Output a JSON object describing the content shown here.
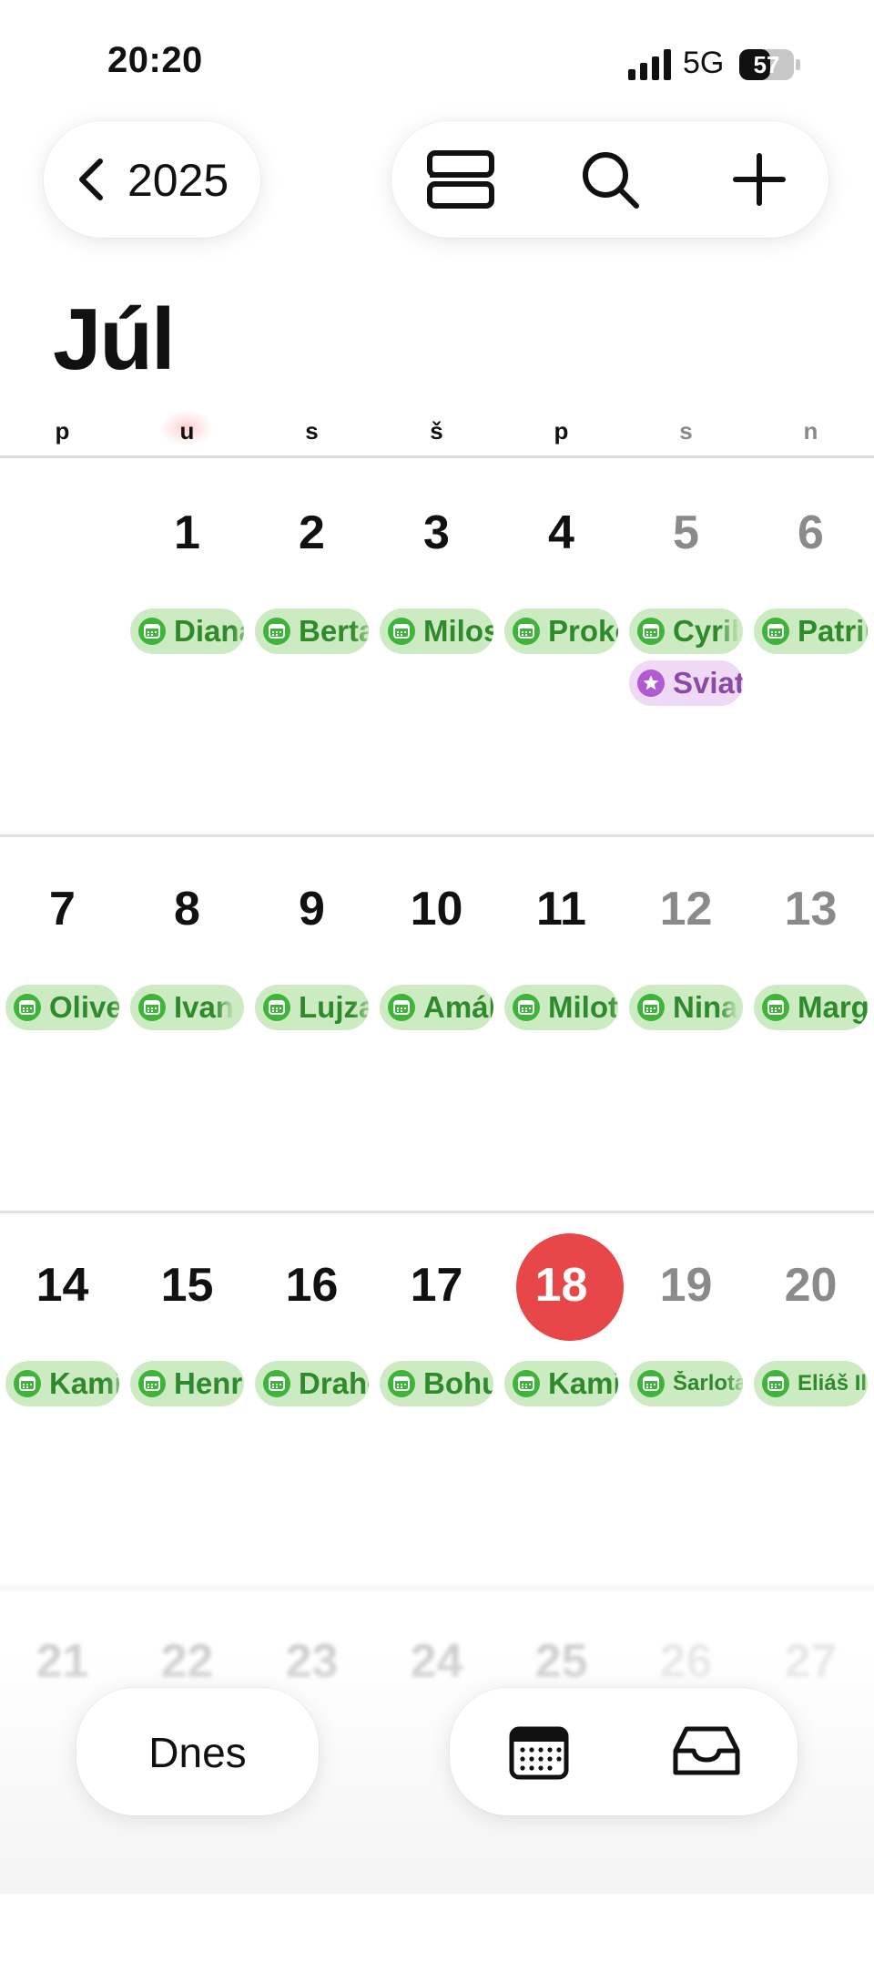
{
  "status_bar": {
    "time": "20:20",
    "network": "5G",
    "battery": "57"
  },
  "header": {
    "back_label": "2025"
  },
  "month": {
    "title": "Júl"
  },
  "weekdays": [
    "p",
    "u",
    "s",
    "š",
    "p",
    "s",
    "n"
  ],
  "weeks": [
    {
      "days": [
        {
          "num": "",
          "events": []
        },
        {
          "num": "1",
          "events": [
            {
              "label": "Diana"
            }
          ]
        },
        {
          "num": "2",
          "events": [
            {
              "label": "Berta"
            }
          ]
        },
        {
          "num": "3",
          "events": [
            {
              "label": "Miloslav"
            }
          ]
        },
        {
          "num": "4",
          "events": [
            {
              "label": "Prokop"
            }
          ]
        },
        {
          "num": "5",
          "weekend": true,
          "events": [
            {
              "label": "Cyril"
            },
            {
              "label": "Sviatok",
              "type": "holiday"
            }
          ]
        },
        {
          "num": "6",
          "weekend": true,
          "events": [
            {
              "label": "Patrik"
            }
          ]
        }
      ]
    },
    {
      "days": [
        {
          "num": "7",
          "events": [
            {
              "label": "Oliver"
            }
          ]
        },
        {
          "num": "8",
          "events": [
            {
              "label": "Ivan"
            }
          ]
        },
        {
          "num": "9",
          "events": [
            {
              "label": "Lujza"
            }
          ]
        },
        {
          "num": "10",
          "events": [
            {
              "label": "Amália"
            }
          ]
        },
        {
          "num": "11",
          "events": [
            {
              "label": "Milota"
            }
          ]
        },
        {
          "num": "12",
          "weekend": true,
          "events": [
            {
              "label": "Nina"
            }
          ]
        },
        {
          "num": "13",
          "weekend": true,
          "events": [
            {
              "label": "Margita"
            }
          ]
        }
      ]
    },
    {
      "days": [
        {
          "num": "14",
          "events": [
            {
              "label": "Kamil"
            }
          ]
        },
        {
          "num": "15",
          "events": [
            {
              "label": "Henrieta"
            }
          ]
        },
        {
          "num": "16",
          "events": [
            {
              "label": "Drahomír"
            }
          ]
        },
        {
          "num": "17",
          "events": [
            {
              "label": "Bohuslav"
            }
          ]
        },
        {
          "num": "18",
          "today": true,
          "events": [
            {
              "label": "Kamila"
            }
          ]
        },
        {
          "num": "19",
          "weekend": true,
          "events": [
            {
              "label": "Šarlota",
              "small": true
            }
          ]
        },
        {
          "num": "20",
          "weekend": true,
          "events": [
            {
              "label": "Eliáš Ilja",
              "small": true
            }
          ]
        }
      ]
    },
    {
      "days": [
        {
          "num": "21",
          "events": []
        },
        {
          "num": "22",
          "events": []
        },
        {
          "num": "23",
          "events": []
        },
        {
          "num": "24",
          "events": []
        },
        {
          "num": "25",
          "events": []
        },
        {
          "num": "26",
          "weekend": true,
          "events": []
        },
        {
          "num": "27",
          "weekend": true,
          "events": []
        }
      ]
    }
  ],
  "bottom": {
    "today_label": "Dnes"
  },
  "colors": {
    "today_accent": "#e8474a",
    "event_bg": "#cdebc2",
    "event_text": "#2f8a2c",
    "holiday_bg": "#efd9f5",
    "holiday_text": "#8c4aa7"
  },
  "icons": {
    "back": "chevron-left-icon",
    "view": "list-view-icon",
    "search": "search-icon",
    "add": "plus-icon",
    "calendar": "calendar-icon",
    "inbox": "inbox-icon",
    "event": "calendar-event-icon",
    "holiday": "star-icon"
  }
}
